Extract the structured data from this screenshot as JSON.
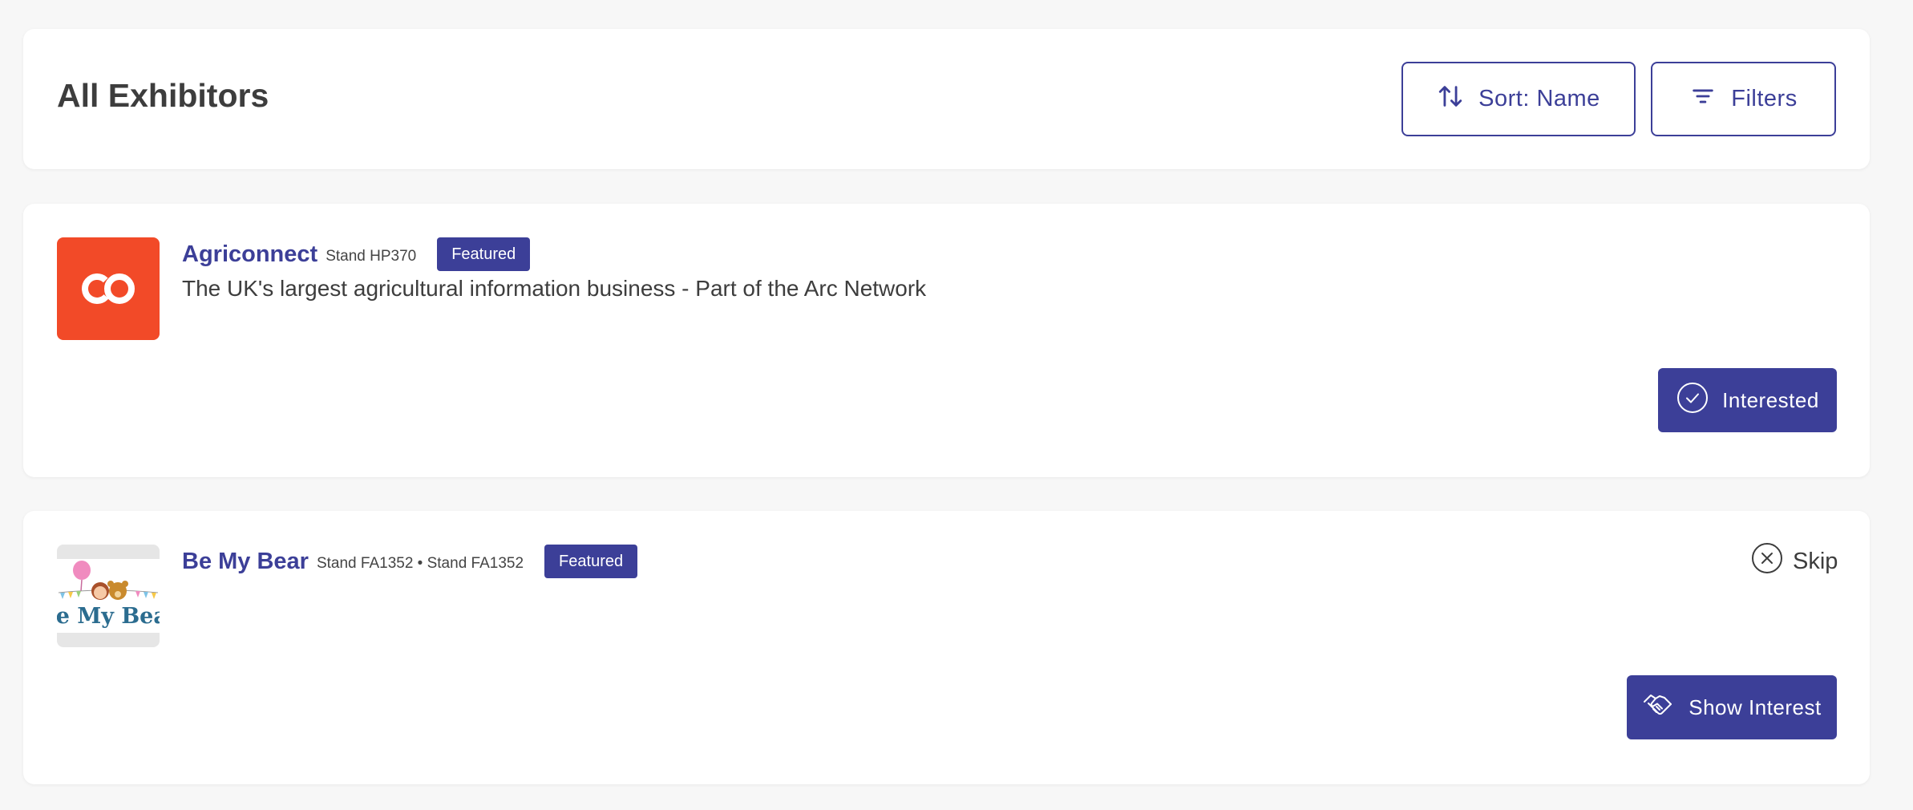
{
  "header": {
    "title": "All Exhibitors",
    "sort_label": "Sort: Name",
    "filters_label": "Filters"
  },
  "colors": {
    "accent": "#3c3f98",
    "agri_logo_bg": "#f24a28"
  },
  "exhibitors": [
    {
      "name": "Agriconnect",
      "stand": "Stand HP370",
      "badge": "Featured",
      "description": "The UK's largest agricultural information business - Part of the Arc Network",
      "action_label": "Interested",
      "action_icon": "check-circle-icon",
      "logo_text": "co"
    },
    {
      "name": "Be My Bear",
      "stand": "Stand FA1352 • Stand FA1352",
      "badge": "Featured",
      "description": "",
      "skip_label": "Skip",
      "action_label": "Show Interest",
      "action_icon": "handshake-icon",
      "logo_text": "Be My Bear"
    }
  ]
}
